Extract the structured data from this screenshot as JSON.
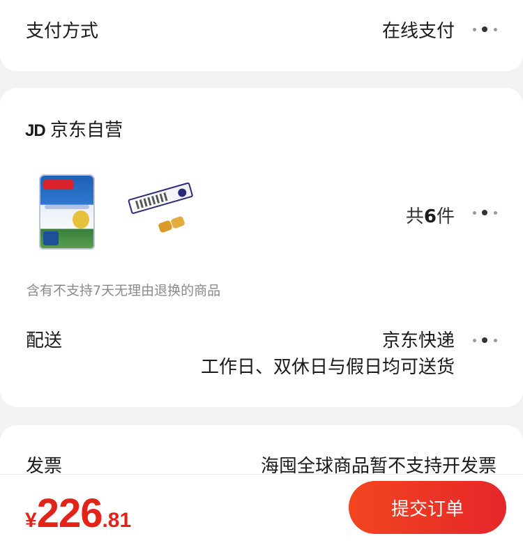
{
  "payment": {
    "label": "支付方式",
    "value": "在线支付"
  },
  "store": {
    "logo": "JD",
    "name": "京东自营",
    "products": [
      {
        "name": "Anchor 奶粉"
      },
      {
        "name": "龍角散 润喉糖"
      }
    ],
    "count": {
      "prefix": "共",
      "number": "6",
      "suffix": "件"
    },
    "notice": "含有不支持7天无理由退换的商品",
    "delivery": {
      "label": "配送",
      "method": "京东快递",
      "schedule": "工作日、双休日与假日均可送货"
    }
  },
  "invoice": {
    "label": "发票",
    "value": "海囤全球商品暂不支持开发票"
  },
  "footer": {
    "currency": "¥",
    "price_int": "226",
    "price_dec": ".81",
    "submit_label": "提交订单"
  },
  "colors": {
    "accent": "#e2231a",
    "button_start": "#f2451f",
    "button_end": "#e5262a",
    "background": "#f2f2f2"
  },
  "icons": [
    "more-dots-icon",
    "jd-logo-icon"
  ]
}
